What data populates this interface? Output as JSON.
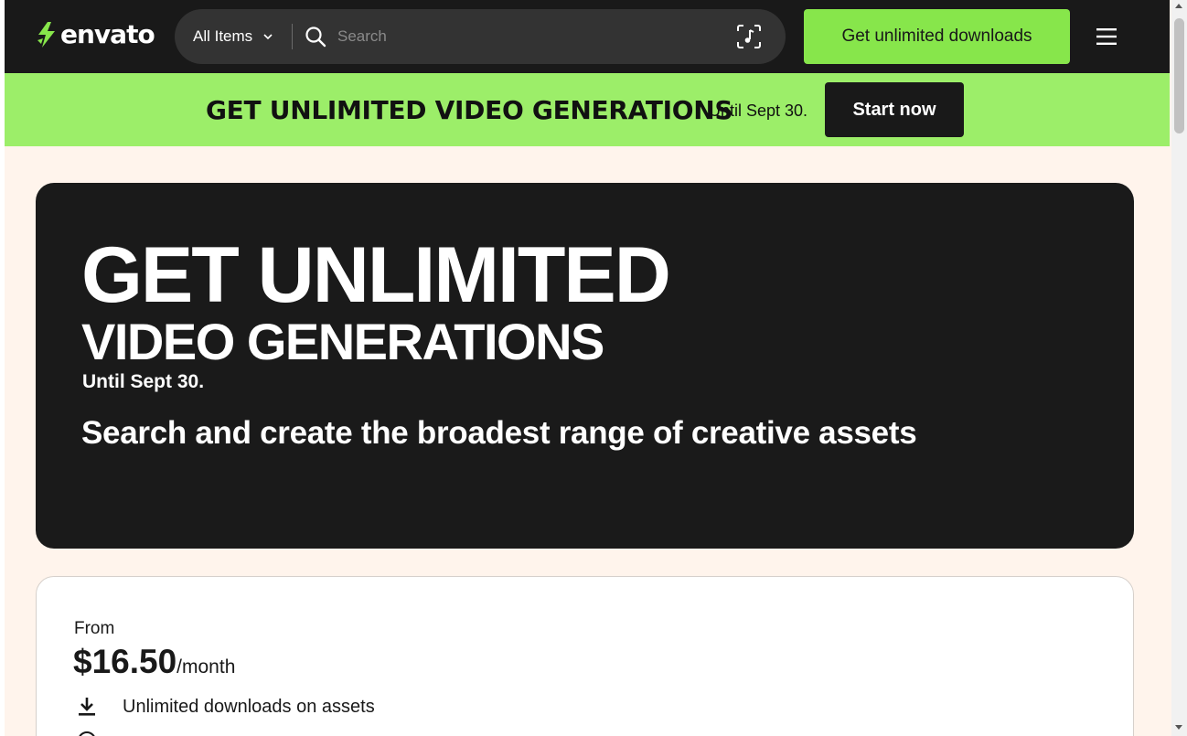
{
  "header": {
    "logo_text": "envato",
    "category_select": "All Items",
    "search_placeholder": "Search",
    "cta_label": "Get unlimited downloads"
  },
  "promo": {
    "title": "GET UNLIMITED VIDEO GENERATIONS",
    "date": "Until Sept 30.",
    "button": "Start now"
  },
  "hero": {
    "line1": "GET UNLIMITED",
    "line2": "VIDEO GENERATIONS",
    "date": "Until Sept 30.",
    "subtitle": "Search and create the broadest range of creative assets"
  },
  "pricing": {
    "from": "From",
    "price": "$16.50",
    "period": "/month",
    "features": [
      "Unlimited downloads on assets"
    ]
  },
  "colors": {
    "header_bg": "#191919",
    "brand_green": "#87e64b",
    "promo_green": "#9cee69",
    "page_bg": "#fff4ec",
    "hero_bg": "#1a1a1a"
  },
  "icons": {
    "logo": "envato-leaf-icon",
    "category": "chevron-down-icon",
    "search": "search-icon",
    "music_search": "music-search-icon",
    "menu": "hamburger-menu-icon",
    "feature_1": "download-icon",
    "feature_2": "info-circle-icon"
  }
}
